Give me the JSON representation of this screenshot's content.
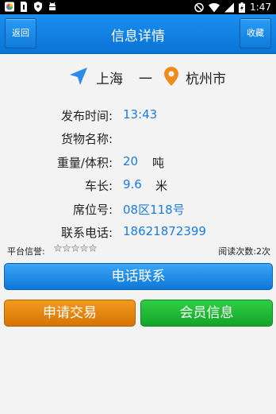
{
  "status_bar": {
    "time": "1:47",
    "left_icons": [
      "colorful-app-icon",
      "sim-card-icon",
      "shield-icon",
      "android-debug-icon"
    ],
    "right_icons": [
      "do-not-disturb-icon",
      "wifi-icon",
      "signal-icon",
      "battery-charging-icon"
    ]
  },
  "header": {
    "back_label": "返回",
    "title": "信息详情",
    "favorite_label": "收藏"
  },
  "route": {
    "from": "上海",
    "separator": "一",
    "to": "杭州市"
  },
  "details": {
    "publish_time": {
      "label": "发布时间:",
      "value": "13:43"
    },
    "goods_name": {
      "label": "货物名称:",
      "value": ""
    },
    "weight_volume": {
      "label": "重量/体积:",
      "value": "20",
      "unit": "吨"
    },
    "vehicle_length": {
      "label": "车长:",
      "value": "9.6",
      "unit": "米"
    },
    "seat_number": {
      "label": "席位号:",
      "value": "08区118号"
    },
    "contact_phone": {
      "label": "联系电话:",
      "value": "18621872399"
    }
  },
  "rating": {
    "label": "平台信誉:",
    "stars_filled": 0,
    "stars_total": 5,
    "read_count_text": "阅读次数:2次"
  },
  "actions": {
    "call_label": "电话联系",
    "apply_label": "申请交易",
    "member_label": "会员信息"
  },
  "colors": {
    "accent_blue": "#0d78d8",
    "value_blue": "#1a7de0",
    "apply_orange": "#e68a10",
    "member_green": "#22b935"
  }
}
